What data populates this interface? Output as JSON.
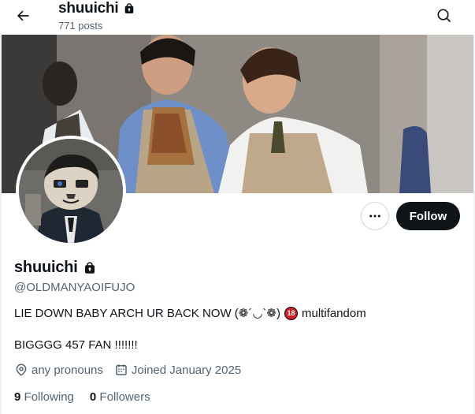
{
  "header": {
    "title": "shuuichi",
    "post_count": "771 posts",
    "back_icon": "arrow-left-icon",
    "search_icon": "search-icon",
    "lock_icon": "lock-icon"
  },
  "profile": {
    "name": "shuuichi",
    "handle": "@OLDMANYAOIFUJO",
    "bio_line1_text": "LIE DOWN BABY ARCH UR BACK NOW (❁´◡`❁)",
    "bio_badge": "18",
    "bio_line1_suffix": "multifandom",
    "bio_line2": "BIGGGG 457 FAN !!!!!!!",
    "pronouns": "any pronouns",
    "joined": "Joined January 2025",
    "following_count": "9",
    "following_label": "Following",
    "followers_count": "0",
    "followers_label": "Followers"
  },
  "actions": {
    "more_icon": "more-dots-icon",
    "follow_label": "Follow"
  },
  "colors": {
    "primary_text": "#0f1419",
    "secondary_text": "#536471",
    "follow_bg": "#0f1419",
    "badge_red": "#d11f2a"
  }
}
